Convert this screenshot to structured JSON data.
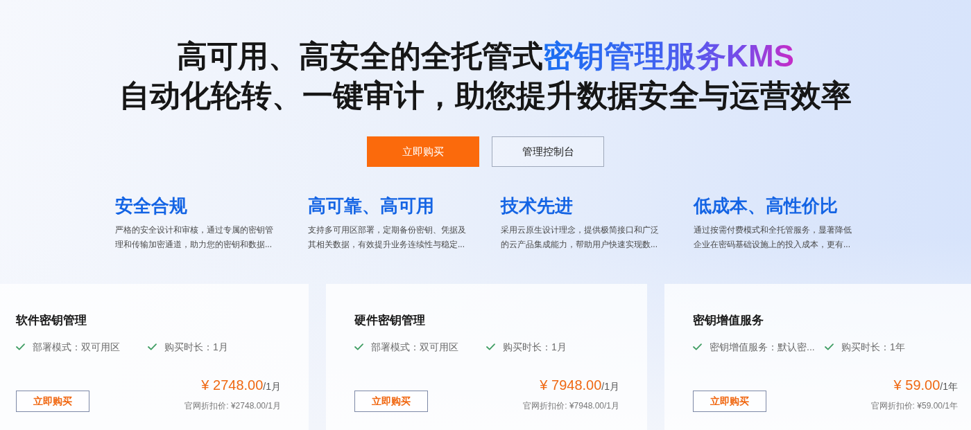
{
  "hero": {
    "title_lines": [
      {
        "segments": [
          {
            "text": "高可用、高安全的全托管式",
            "highlight": false
          },
          {
            "text": "密钥管理服务KMS",
            "highlight": true
          }
        ]
      },
      {
        "segments": [
          {
            "text": "自动化轮转、一键审计，助您提升数据安全与运营效率",
            "highlight": false
          }
        ]
      }
    ],
    "buttons": [
      {
        "label": "立即购买",
        "kind": "primary"
      },
      {
        "label": "管理控制台",
        "kind": "secondary"
      }
    ]
  },
  "features": [
    {
      "title": "安全合规",
      "description": "严格的安全设计和审核，通过专属的密钥管理和传输加密通道，助力您的密钥和数据..."
    },
    {
      "title": "高可靠、高可用",
      "description": "支持多可用区部署，定期备份密钥、凭据及其相关数据，有效提升业务连续性与稳定..."
    },
    {
      "title": "技术先进",
      "description": "采用云原生设计理念，提供极简接口和广泛的云产品集成能力，帮助用户快速实现数..."
    },
    {
      "title": "低成本、高性价比",
      "description": "通过按需付费模式和全托管服务，显著降低企业在密码基础设施上的投入成本，更有..."
    }
  ],
  "products": [
    {
      "name": "软件密钥管理",
      "specs": [
        "部署模式：双可用区",
        "购买时长：1月"
      ],
      "price": "¥ 2748.00",
      "unit": "/1月",
      "discount": "官网折扣价: ¥2748.00/1月",
      "button": "立即购买"
    },
    {
      "name": "硬件密钥管理",
      "specs": [
        "部署模式：双可用区",
        "购买时长：1月"
      ],
      "price": "¥ 7948.00",
      "unit": "/1月",
      "discount": "官网折扣价: ¥7948.00/1月",
      "button": "立即购买"
    },
    {
      "name": "密钥增值服务",
      "specs": [
        "密钥增值服务：默认密...",
        "购买时长：1年"
      ],
      "price": "¥ 59.00",
      "unit": "/1年",
      "discount": "官网折扣价: ¥59.00/1年",
      "button": "立即购买"
    }
  ]
}
